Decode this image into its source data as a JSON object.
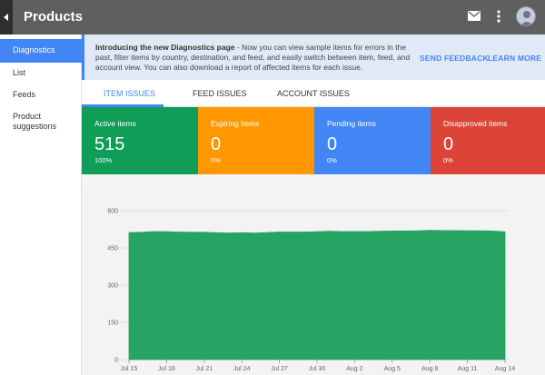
{
  "header": {
    "title": "Products"
  },
  "sidebar": {
    "items": [
      {
        "label": "Diagnostics"
      },
      {
        "label": "List"
      },
      {
        "label": "Feeds"
      },
      {
        "label": "Product suggestions"
      }
    ]
  },
  "banner": {
    "heading": "Introducing the new Diagnostics page",
    "text": " - Now you can view sample items for errors in the past, filter items by country, destination, and feed, and easily switch between item, feed, and account view. You can also download a report of affected items for each issue.",
    "send_feedback": "SEND FEEDBACK",
    "learn_more": "LEARN MORE"
  },
  "tabs": [
    {
      "label": "ITEM ISSUES"
    },
    {
      "label": "FEED ISSUES"
    },
    {
      "label": "ACCOUNT ISSUES"
    }
  ],
  "cards": [
    {
      "label": "Active items",
      "value": "515",
      "pct": "100%",
      "color": "#0f9d58"
    },
    {
      "label": "Expiring items",
      "value": "0",
      "pct": "0%",
      "color": "#ff9800"
    },
    {
      "label": "Pending items",
      "value": "0",
      "pct": "0%",
      "color": "#4285f4"
    },
    {
      "label": "Disapproved items",
      "value": "0",
      "pct": "0%",
      "color": "#db4437"
    }
  ],
  "chart_data": {
    "type": "area",
    "color": "#27a463",
    "ylim": [
      0,
      600
    ],
    "yticks": [
      "600",
      "450",
      "300",
      "150",
      "0"
    ],
    "xticks": [
      "Jul 15",
      "Jul 18",
      "Jul 21",
      "Jul 24",
      "Jul 27",
      "Jul 30",
      "Aug 2",
      "Aug 5",
      "Aug 8",
      "Aug 11",
      "Aug 14"
    ],
    "x": [
      "Jul 15",
      "Jul 16",
      "Jul 17",
      "Jul 18",
      "Jul 19",
      "Jul 20",
      "Jul 21",
      "Jul 22",
      "Jul 23",
      "Jul 24",
      "Jul 25",
      "Jul 26",
      "Jul 27",
      "Jul 28",
      "Jul 29",
      "Jul 30",
      "Jul 31",
      "Aug 1",
      "Aug 2",
      "Aug 3",
      "Aug 4",
      "Aug 5",
      "Aug 6",
      "Aug 7",
      "Aug 8",
      "Aug 9",
      "Aug 10",
      "Aug 11",
      "Aug 12",
      "Aug 13",
      "Aug 14"
    ],
    "values": [
      512,
      513,
      516,
      515,
      514,
      513,
      513,
      511,
      510,
      511,
      510,
      512,
      514,
      514,
      514,
      515,
      517,
      516,
      516,
      516,
      517,
      518,
      518,
      519,
      521,
      520,
      520,
      519,
      519,
      518,
      515
    ]
  }
}
